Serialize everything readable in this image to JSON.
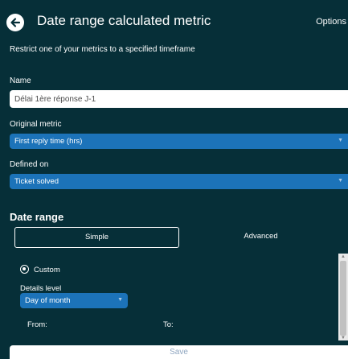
{
  "header": {
    "title": "Date range calculated metric",
    "options_label": "Options",
    "back_icon": "arrow-left-circle-icon"
  },
  "subtitle": "Restrict one of your metrics to a specified timeframe",
  "fields": {
    "name_label": "Name",
    "name_value": "Délai 1ère réponse J-1",
    "original_metric_label": "Original metric",
    "original_metric_value": "First reply time (hrs)",
    "defined_on_label": "Defined on",
    "defined_on_value": "Ticket solved",
    "caret": "▼"
  },
  "date_range": {
    "title": "Date range",
    "tabs": {
      "simple": "Simple",
      "advanced": "Advanced",
      "selected": "simple"
    },
    "radio_label": "Custom",
    "radio_selected": true,
    "details_level_label": "Details level",
    "details_level_value": "Day of month",
    "from_label": "From:",
    "to_label": "To:"
  },
  "scrollbar": {
    "up_glyph": "▲",
    "down_glyph": "▼"
  },
  "save_label": "Save",
  "colors": {
    "background": "#062f38",
    "select_blue": "#1c73b9",
    "save_text": "#8fa6c0"
  }
}
